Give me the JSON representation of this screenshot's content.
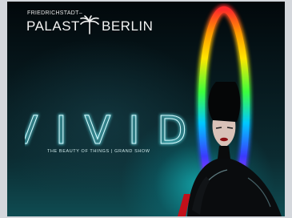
{
  "brand": {
    "top_line": "FRIEDRICHSTADT–",
    "left_word": "PALAST",
    "right_word": "BERLIN",
    "logo_icon": "palm-tree-icon"
  },
  "show": {
    "title": "VIVID",
    "subtitle": "THE BEAUTY OF THINGS | GRAND SHOW"
  },
  "colors": {
    "background_top": "#02080b",
    "background_bottom": "#0f4c52",
    "title_neon": "#5ad7e0",
    "ring": [
      "#ff2a2a",
      "#ff9a00",
      "#ffe600",
      "#3cff3c",
      "#00c8ff",
      "#3a3aff",
      "#c03cff"
    ]
  }
}
